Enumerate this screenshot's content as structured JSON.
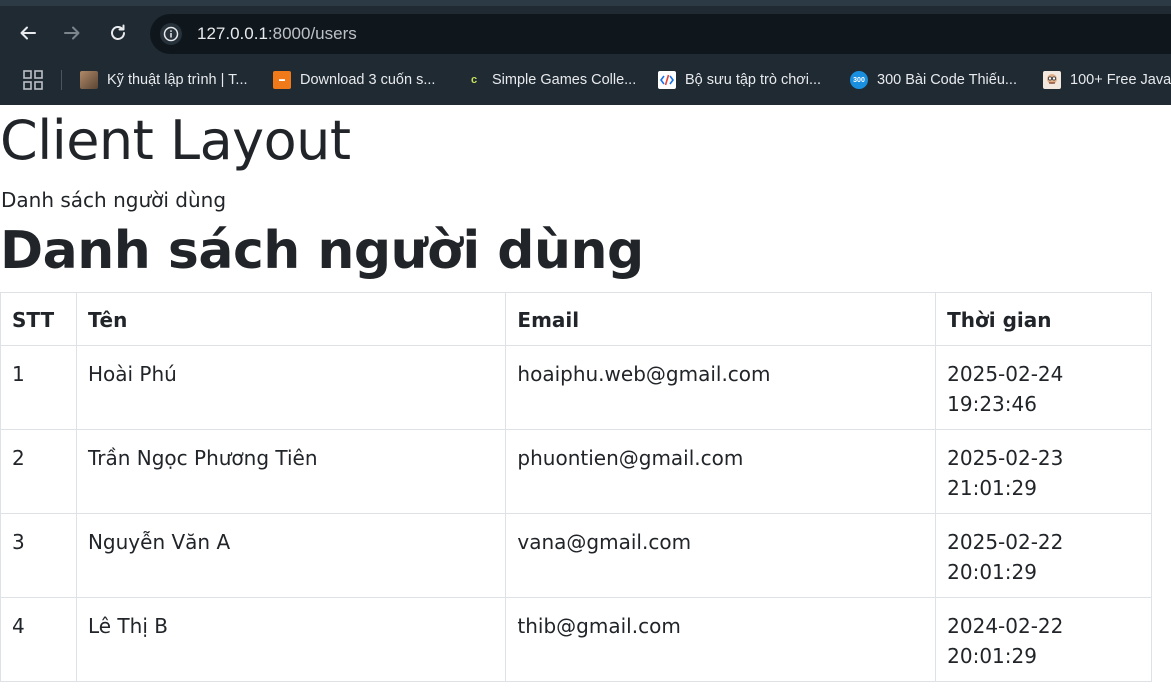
{
  "browser": {
    "url_host": "127.0.0.1",
    "url_path": ":8000/users",
    "bookmarks": [
      {
        "label": "Kỹ thuật lập trình | T...",
        "icon": "photo-favicon-icon",
        "color": "#8a6a55"
      },
      {
        "label": "Download 3 cuốn s...",
        "icon": "orange-favicon-icon",
        "color": "#f07a1a"
      },
      {
        "label": "Simple Games Colle...",
        "icon": "c-favicon-icon",
        "color": "#1f2a33"
      },
      {
        "label": "Bộ sưu tập trò chơi...",
        "icon": "code-favicon-icon",
        "color": "#ffffff"
      },
      {
        "label": "300 Bài Code Thiếu...",
        "icon": "300-favicon-icon",
        "color": "#1a8fe0"
      },
      {
        "label": "100+ Free Java",
        "icon": "avatar-favicon-icon",
        "color": "#f2e8e0"
      }
    ]
  },
  "page": {
    "layout_title": "Client Layout",
    "sub_text": "Danh sách người dùng",
    "list_title": "Danh sách người dùng"
  },
  "table": {
    "headers": {
      "stt": "STT",
      "name": "Tên",
      "email": "Email",
      "time": "Thời gian"
    },
    "rows": [
      {
        "stt": "1",
        "name": "Hoài Phú",
        "email": "hoaiphu.web@gmail.com",
        "date": "2025-02-24",
        "time": "19:23:46"
      },
      {
        "stt": "2",
        "name": "Trần Ngọc Phương Tiên",
        "email": "phuontien@gmail.com",
        "date": "2025-02-23",
        "time": "21:01:29"
      },
      {
        "stt": "3",
        "name": "Nguyễn Văn A",
        "email": "vana@gmail.com",
        "date": "2025-02-22",
        "time": "20:01:29"
      },
      {
        "stt": "4",
        "name": "Lê Thị B",
        "email": "thib@gmail.com",
        "date": "2024-02-22",
        "time": "20:01:29"
      }
    ]
  },
  "colors": {
    "chrome_bg": "#1f2a33",
    "omnibox_bg": "#0f171d",
    "text": "#212529",
    "table_border": "#dee2e6"
  }
}
